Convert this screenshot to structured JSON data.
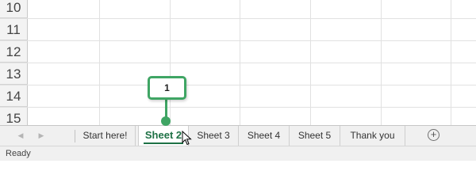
{
  "grid": {
    "rows": [
      "10",
      "11",
      "12",
      "13",
      "14",
      "15"
    ]
  },
  "callout": {
    "label": "1"
  },
  "sheet_tabs": [
    {
      "label": "Start here!"
    },
    {
      "label": "Sheet 2",
      "active": true
    },
    {
      "label": "Sheet 3"
    },
    {
      "label": "Sheet 4"
    },
    {
      "label": "Sheet 5"
    },
    {
      "label": "Thank you"
    }
  ],
  "status": {
    "text": "Ready"
  },
  "icons": {
    "scroll_left": "triangle-left-icon",
    "scroll_right": "triangle-right-icon",
    "add_sheet": "plus-circle-icon",
    "cursor": "mouse-pointer-icon"
  },
  "colors": {
    "accent": "#1e7145",
    "callout": "#3fa564"
  }
}
